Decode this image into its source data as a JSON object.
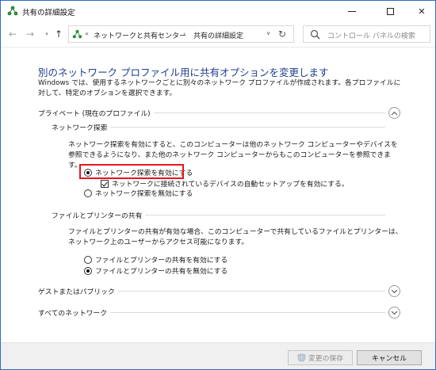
{
  "window": {
    "title": "共有の詳細設定"
  },
  "nav": {
    "breadcrumb_prefix": "«",
    "crumbs": [
      "ネットワークと共有センター",
      "共有の詳細設定"
    ],
    "search_placeholder": "コントロール パネルの検索"
  },
  "main": {
    "heading": "別のネットワーク プロファイル用に共有オプションを変更します",
    "intro": "Windows では、使用するネットワークごとに別々のネットワーク プロファイルが作成されます。各プロファイルに対して、特定のオプションを選択できます。",
    "profiles": [
      {
        "label": "プライベート (現在のプロファイル)",
        "expanded": true,
        "sections": [
          {
            "label": "ネットワーク探索",
            "description": "ネットワーク探索を有効にすると、このコンピューターは他のネットワーク コンピューターやデバイスを参照できるようになり、また他のネットワーク コンピューターからもこのコンピューターを参照できます。",
            "options": [
              {
                "type": "radio",
                "label": "ネットワーク探索を有効にする",
                "checked": true
              },
              {
                "type": "checkbox",
                "label": "ネットワークに接続されているデバイスの自動セットアップを有効にする。",
                "checked": true
              },
              {
                "type": "radio",
                "label": "ネットワーク探索を無効にする",
                "checked": false
              }
            ]
          },
          {
            "label": "ファイルとプリンターの共有",
            "description": "ファイルとプリンターの共有が有効な場合、このコンピューターで共有しているファイルとプリンターは、ネットワーク上のユーザーからアクセス可能になります。",
            "options": [
              {
                "type": "radio",
                "label": "ファイルとプリンターの共有を有効にする",
                "checked": false
              },
              {
                "type": "radio",
                "label": "ファイルとプリンターの共有を無効にする",
                "checked": true
              }
            ]
          }
        ]
      },
      {
        "label": "ゲストまたはパブリック",
        "expanded": false
      },
      {
        "label": "すべてのネットワーク",
        "expanded": false
      }
    ]
  },
  "footer": {
    "save_label": "変更の保存",
    "cancel_label": "キャンセル"
  },
  "colors": {
    "heading": "#1f3f8f",
    "highlight_border": "#e8141e",
    "window_border": "#2b6cc4"
  }
}
